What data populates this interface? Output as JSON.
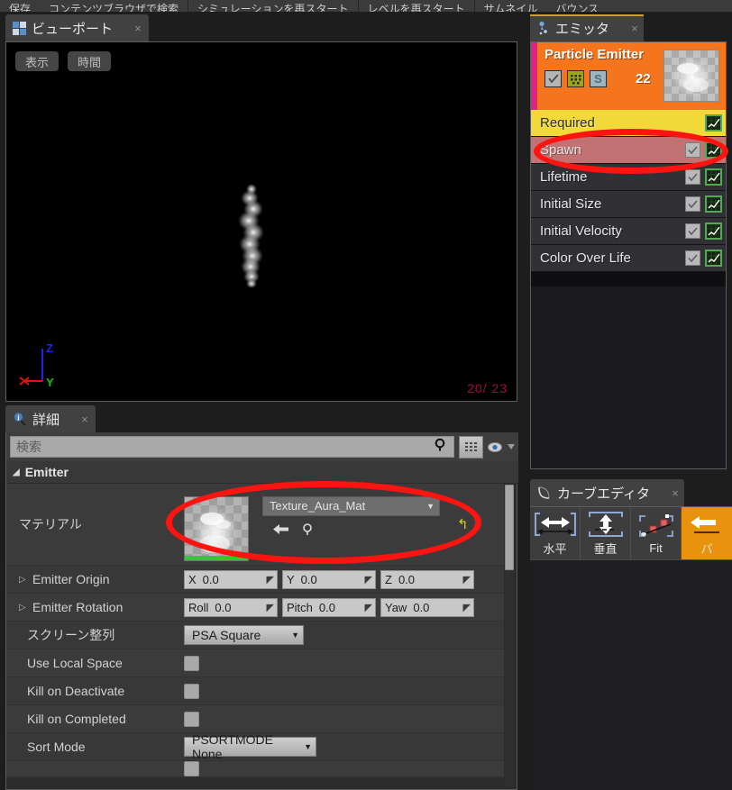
{
  "top_toolbar": {
    "items": [
      "保存",
      "コンテンツブラウザで検索",
      "シミュレーションを再スタート",
      "レベルを再スタート",
      "サムネイル",
      "バウンス"
    ]
  },
  "viewport": {
    "tab": {
      "title": "ビューポート",
      "icon": "grid-viewport-icon",
      "close": "×"
    },
    "buttons": [
      {
        "name": "show",
        "label": "表示"
      },
      {
        "name": "time",
        "label": "時間"
      }
    ],
    "axis": {
      "x": "X",
      "y": "Y",
      "z": "Z",
      "x_color": "#e01010",
      "y_color": "#12c412",
      "z_color": "#2222ee"
    },
    "particle_counter": "20/ 23",
    "counter_color": "#a6073b",
    "background": "#000000"
  },
  "details": {
    "tab": {
      "title": "詳細",
      "icon": "info-magnifier-icon",
      "close": "×"
    },
    "search": {
      "placeholder": "検索",
      "value": "",
      "icon": "search-icon"
    },
    "toolbar_buttons": [
      {
        "name": "grid-view-button",
        "icon": "grid-icon"
      },
      {
        "name": "visibility-button",
        "icon": "eye-icon"
      }
    ],
    "category": {
      "label": "Emitter",
      "expanded": true,
      "triangle": "▲"
    },
    "material_row": {
      "label": "マテリアル",
      "value": "Texture_Aura_Mat",
      "caret": "▼",
      "back_icon": "arrow-left-icon",
      "browse_icon": "magnifier-icon",
      "reset_icon": "reset-arrow-icon",
      "thumbnail": "texture-aura-thumbnail"
    },
    "rows": [
      {
        "label": "Emitter Origin",
        "expandable": true,
        "type": "vector",
        "fields": [
          {
            "key": "X",
            "value": "0.0"
          },
          {
            "key": "Y",
            "value": "0.0"
          },
          {
            "key": "Z",
            "value": "0.0"
          }
        ]
      },
      {
        "label": "Emitter Rotation",
        "expandable": true,
        "type": "vector",
        "fields": [
          {
            "key": "Roll",
            "value": "0.0"
          },
          {
            "key": "Pitch",
            "value": "0.0"
          },
          {
            "key": "Yaw",
            "value": "0.0"
          }
        ]
      },
      {
        "label": "スクリーン整列",
        "expandable": false,
        "type": "combo",
        "value": "PSA Square",
        "width": 133
      },
      {
        "label": "Use Local Space",
        "expandable": false,
        "type": "checkbox",
        "checked": false
      },
      {
        "label": "Kill on Deactivate",
        "expandable": false,
        "type": "checkbox",
        "checked": false
      },
      {
        "label": "Kill on Completed",
        "expandable": false,
        "type": "checkbox",
        "checked": false
      },
      {
        "label": "Sort Mode",
        "expandable": false,
        "type": "combo",
        "value": "PSORTMODE None",
        "width": 147
      },
      {
        "label": "",
        "expandable": false,
        "type": "checkbox",
        "checked": false
      }
    ]
  },
  "emitter": {
    "tab": {
      "title": "エミッタ",
      "icon": "emitter-icon",
      "close": "×"
    },
    "header": {
      "title": "Particle Emitter",
      "count": "22",
      "accent_color": "#f4751e",
      "stripe_color": "#e0218a",
      "icons": [
        {
          "name": "enabled-checkbox",
          "glyph": "✓"
        },
        {
          "name": "render-grid-icon",
          "glyph": ""
        },
        {
          "name": "solo-button",
          "glyph": "S"
        }
      ]
    },
    "modules": [
      {
        "name": "Required",
        "state": "selected",
        "has_checkbox": false,
        "curve": true
      },
      {
        "name": "Spawn",
        "state": "error",
        "has_checkbox": true,
        "curve": true
      },
      {
        "name": "Lifetime",
        "state": "normal",
        "has_checkbox": true,
        "curve": true
      },
      {
        "name": "Initial Size",
        "state": "normal",
        "has_checkbox": true,
        "curve": true
      },
      {
        "name": "Initial Velocity",
        "state": "normal",
        "has_checkbox": true,
        "curve": true
      },
      {
        "name": "Color Over Life",
        "state": "normal",
        "has_checkbox": true,
        "curve": true
      }
    ]
  },
  "curve_editor": {
    "tab": {
      "title": "カーブエディタ",
      "icon": "curve-icon",
      "close": "×"
    },
    "buttons": [
      {
        "name": "horizontal",
        "label": "水平",
        "icon": "horizontal-fit-icon"
      },
      {
        "name": "vertical",
        "label": "垂直",
        "icon": "vertical-fit-icon"
      },
      {
        "name": "fit",
        "label": "Fit",
        "icon": "fit-icon"
      },
      {
        "name": "pan",
        "label": "パ",
        "icon": "pan-icon",
        "highlighted": true
      }
    ]
  },
  "annotations": [
    {
      "name": "required-module-highlight",
      "color": "#fb1410",
      "shape": "ellipse"
    },
    {
      "name": "material-property-highlight",
      "color": "#fb1410",
      "shape": "ellipse"
    }
  ]
}
